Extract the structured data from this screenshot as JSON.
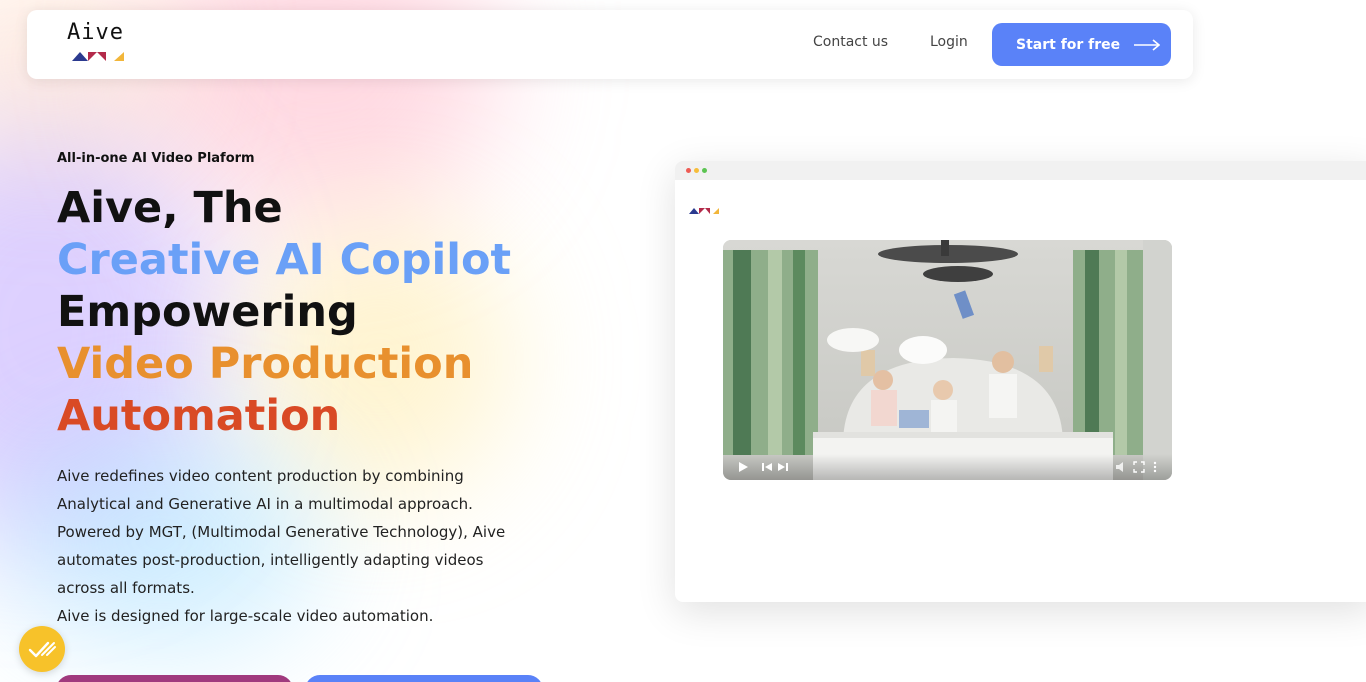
{
  "brand": {
    "name": "Aive",
    "colors": {
      "blue": "#5a82f8",
      "red": "#b32a4a",
      "navy": "#2b3a8f",
      "yellow": "#f2b63a"
    }
  },
  "nav": {
    "contact_label": "Contact us",
    "login_label": "Login",
    "cta_label": "Start for free",
    "cta_icon": "arrow-right-icon"
  },
  "hero": {
    "eyebrow": "All-in-one AI Video Plaform",
    "headline": {
      "line1": "Aive, The",
      "line2": "Creative AI Copilot",
      "line3": "Empowering",
      "line4": "Video Production",
      "line5": "Automation"
    },
    "description": [
      "Aive redefines video content production by combining",
      "Analytical and Generative AI in a multimodal approach.",
      "Powered by MGT, (Multimodal Generative Technology), Aive",
      "automates post-production, intelligently adapting videos",
      "across all formats.",
      "Aive is designed for large-scale video automation."
    ]
  },
  "widget": {
    "chat_icon": "check-lines-icon",
    "color": "#f7c22a"
  },
  "mockup": {
    "video_controls": [
      "play-icon",
      "previous-icon",
      "next-icon",
      "volume-icon",
      "fullscreen-icon",
      "more-icon"
    ]
  }
}
